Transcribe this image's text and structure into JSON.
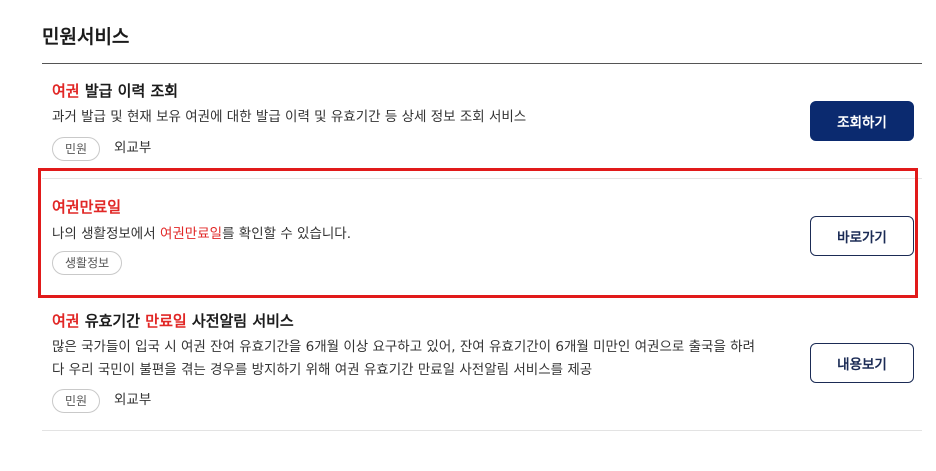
{
  "section": {
    "title": "민원서비스"
  },
  "items": [
    {
      "title_highlight": "여권",
      "title_rest": " 발급 이력 조회",
      "desc": "과거 발급 및 현재 보유 여권에 대한 발급 이력 및 유효기간 등 상세 정보 조회 서비스",
      "tag": "민원",
      "org": "외교부",
      "button": "조회하기"
    },
    {
      "title_highlight": "여권만료일",
      "desc_pre": "나의 생활정보에서 ",
      "desc_highlight": "여권만료일",
      "desc_post": "를 확인할 수 있습니다.",
      "tag": "생활정보",
      "button": "바로가기"
    },
    {
      "title_hl1": "여권",
      "title_mid": " 유효기간 ",
      "title_hl2": "만료일",
      "title_rest": " 사전알림 서비스",
      "desc_line1": "많은 국가들이 입국 시 여권 잔여 유효기간을 6개월 이상 요구하고 있어, 잔여 유효기간이 6개월 미만인 여권으로 출국을 하려",
      "desc_line2": "다 우리 국민이 불편을 겪는 경우를 방지하기 위해 여권 유효기간 만료일 사전알림 서비스를 제공",
      "tag": "민원",
      "org": "외교부",
      "button": "내용보기"
    }
  ],
  "colors": {
    "highlight": "#e12726",
    "primary_button": "#0b2a6f",
    "focus_box": "#e11a1a"
  }
}
